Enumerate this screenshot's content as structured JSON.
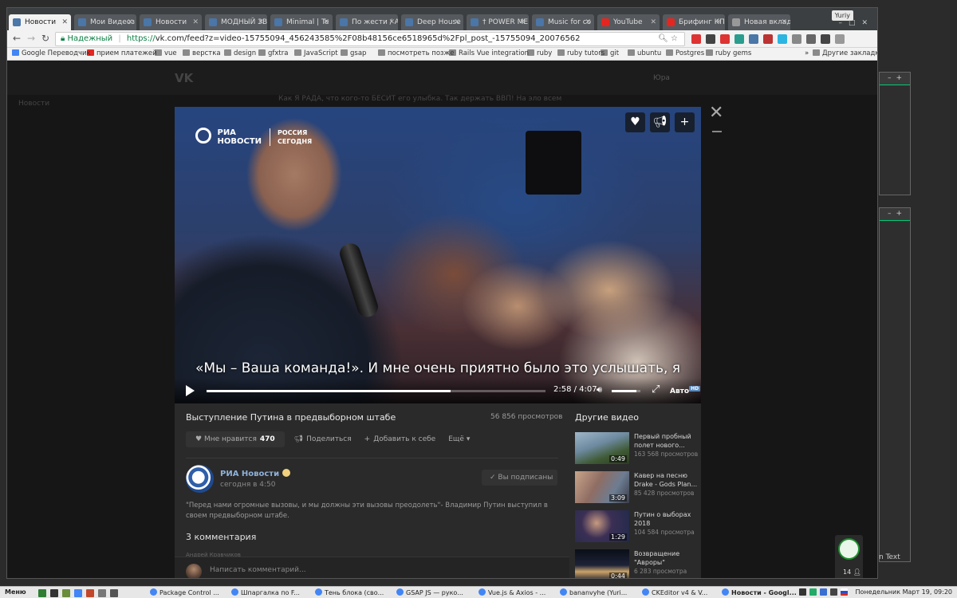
{
  "browser": {
    "user": "Yuriy",
    "tabs": [
      {
        "label": "Новости",
        "active": true,
        "favicon_color": "#4a76a8"
      },
      {
        "label": "Мои Видеоз",
        "favicon_color": "#4a76a8"
      },
      {
        "label": "Новости",
        "favicon_color": "#4a76a8"
      },
      {
        "label": "МОДНЫЙ ЗВ",
        "favicon_color": "#4a76a8"
      },
      {
        "label": "Minimal | Te",
        "favicon_color": "#4a76a8"
      },
      {
        "label": "По жести / А",
        "favicon_color": "#4a76a8"
      },
      {
        "label": "Deep House",
        "favicon_color": "#4a76a8"
      },
      {
        "label": "† POWER ME",
        "favicon_color": "#4a76a8"
      },
      {
        "label": "Music for co",
        "favicon_color": "#4a76a8"
      },
      {
        "label": "YouTube",
        "favicon_color": "#e52620"
      },
      {
        "label": "Брифинг КП",
        "favicon_color": "#e52620"
      },
      {
        "label": "Новая вкладка",
        "favicon_color": "#999999"
      }
    ],
    "address": {
      "secure_label": "Надежный",
      "scheme": "https://",
      "url": "vk.com/feed?z=video-15755094_456243585%2F08b48156ce6518965d%2Fpl_post_-15755094_20076562"
    },
    "bookmarks": [
      {
        "label": "Google Переводчик",
        "icon": "google"
      },
      {
        "label": "прием платежей",
        "icon": "yandex"
      },
      {
        "label": "vue",
        "icon": "folder"
      },
      {
        "label": "верстка",
        "icon": "folder"
      },
      {
        "label": "design",
        "icon": "folder"
      },
      {
        "label": "gfxtra",
        "icon": "folder"
      },
      {
        "label": "JavaScript",
        "icon": "folder"
      },
      {
        "label": "gsap",
        "icon": "folder"
      },
      {
        "label": "посмотреть позже",
        "icon": "folder"
      },
      {
        "label": "Rails Vue integration",
        "icon": "folder"
      },
      {
        "label": "ruby",
        "icon": "folder"
      },
      {
        "label": "ruby tutors",
        "icon": "folder"
      },
      {
        "label": "git",
        "icon": "folder"
      },
      {
        "label": "ubuntu",
        "icon": "folder"
      },
      {
        "label": "Postgres",
        "icon": "folder"
      },
      {
        "label": "ruby gems",
        "icon": "folder"
      }
    ],
    "bookmarks_more": "»",
    "other_bookmarks": "Другие закладки"
  },
  "vk": {
    "logo": "VK",
    "user": "Юра",
    "side_menu_dim": "Новости",
    "feed_dim": "Как Я РАДА, что кого-то БЕСИТ его улыбка. Так держать ВВП! На эло всем"
  },
  "video": {
    "watermark_top": "РИА",
    "watermark_bottom": "НОВОСТИ",
    "watermark_right_top": "РОССИЯ",
    "watermark_right_bottom": "СЕГОДНЯ",
    "subtitle": "«Мы – Ваша команда!». И мне очень приятно было это услышать,  я",
    "time": "2:58 / 4:07",
    "progress": 0.72,
    "volume": 0.85,
    "quality": "Авто",
    "quality_badge": "HD",
    "title": "Выступление Путина в предвыборном штабе",
    "views": "56 856 просмотров",
    "like_label": "Мне нравится",
    "like_count": "470",
    "share_label": "Поделиться",
    "add_label": "Добавить к себе",
    "more_label": "Ещё"
  },
  "post": {
    "author": "РИА Новости",
    "time": "сегодня в 4:50",
    "subscribed_label": "Вы подписаны",
    "text": "\"Перед нами огромные вызовы, и мы должны эти вызовы преодолеть\"- Владимир Путин выступил в своем предвыборном штабе.",
    "comments_heading": "3 комментария",
    "comment_peek": "Андрей Кравчиков",
    "comment_placeholder": "Написать комментарий..."
  },
  "related": {
    "heading": "Другие видео",
    "items": [
      {
        "title": "Первый пробный полет нового...",
        "views": "163 568 просмотров",
        "duration": "0:49",
        "thumb": "linear-gradient(160deg,#9fb6c9 0%,#6e8aa0 40%,#3f5a34 70%,#2d3b22 100%)"
      },
      {
        "title": "Кавер на песню Drake - Gods Plan...",
        "views": "85 428 просмотров",
        "duration": "3:09",
        "thumb": "linear-gradient(120deg,#c9a58a 0%,#8f6d63 40%,#6d7d92 70%,#3b3d4a 100%)"
      },
      {
        "title": "Путин о выборах 2018",
        "views": "104 584 просмотра",
        "duration": "1:29",
        "thumb": "radial-gradient(circle at 40% 40%,#c89a80 0%,#3b2f55 40%,#202a4a 100%)"
      },
      {
        "title": "Возвращение \"Авроры\"",
        "views": "6 283 просмотра",
        "duration": "0:44",
        "thumb": "linear-gradient(180deg,#0b0e18 0%,#1d2338 50%,#c9a36a 70%,#1a1a22 100%)"
      }
    ]
  },
  "chat": {
    "count": "14"
  },
  "bg_window_text": "n Text",
  "taskbar": {
    "menu": "Меню",
    "tasks": [
      {
        "label": "Package Control ..."
      },
      {
        "label": "Шпаргалка по F..."
      },
      {
        "label": "Тень блока (сво..."
      },
      {
        "label": "GSAP JS — руко..."
      },
      {
        "label": "Vue.js & Axios - ..."
      },
      {
        "label": "bananvyhe (Yuri..."
      },
      {
        "label": "CKEditor v4 & V..."
      },
      {
        "label": "Новости - Googl...",
        "active": true
      }
    ],
    "clock": "Понедельник Март 19, 09:20"
  }
}
